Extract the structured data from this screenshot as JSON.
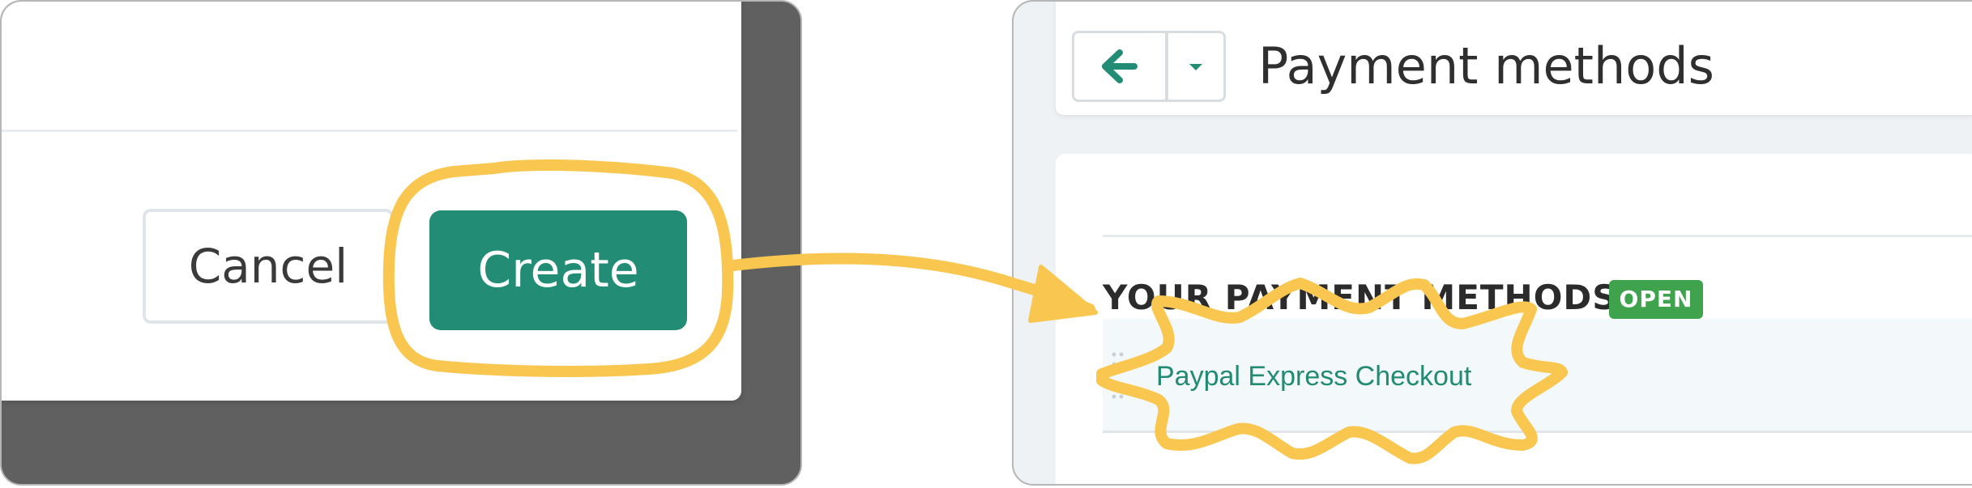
{
  "modal": {
    "cancel_label": "Cancel",
    "create_label": "Create"
  },
  "page": {
    "title": "Payment methods"
  },
  "section": {
    "title": "YOUR PAYMENT METHODS",
    "badge": "OPEN"
  },
  "payment_methods": [
    {
      "name": "Paypal Express Checkout"
    }
  ],
  "colors": {
    "primary": "#228c74",
    "badge_green": "#3fa34d",
    "annotation_yellow": "#f9c74f",
    "modal_backdrop": "#606060"
  },
  "icons": {
    "back": "arrow-left-icon",
    "dropdown": "caret-down-icon",
    "drag": "drag-handle-icon"
  }
}
